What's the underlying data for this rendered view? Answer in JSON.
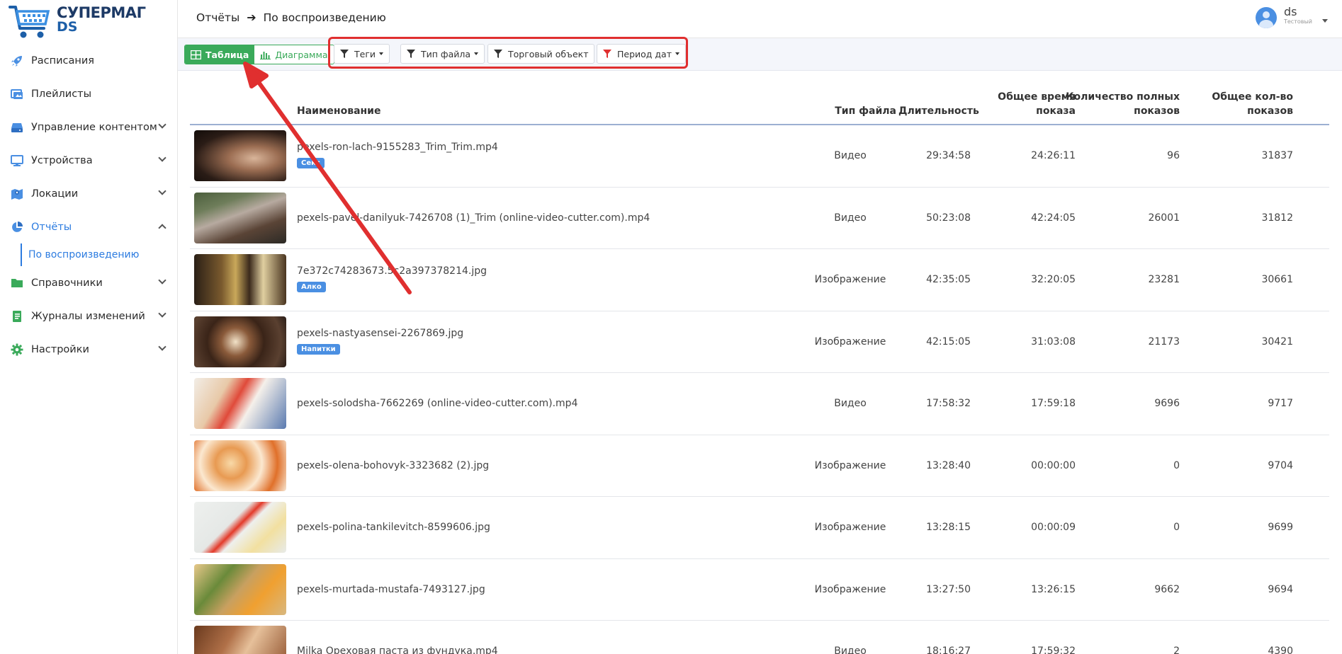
{
  "logo": {
    "line1": "СУПЕРМАГ",
    "line2": "DS"
  },
  "sidebar": {
    "items": [
      {
        "label": "Расписания",
        "icon": "rocket-icon"
      },
      {
        "label": "Плейлисты",
        "icon": "playlist-icon"
      },
      {
        "label": "Управление контентом",
        "icon": "storage-icon"
      },
      {
        "label": "Устройства",
        "icon": "monitor-icon"
      },
      {
        "label": "Локации",
        "icon": "map-icon"
      },
      {
        "label": "Отчёты",
        "icon": "pie-chart-icon"
      },
      {
        "label": "Справочники",
        "icon": "folder-icon"
      },
      {
        "label": "Журналы изменений",
        "icon": "journal-icon"
      },
      {
        "label": "Настройки",
        "icon": "gear-icon"
      }
    ],
    "sub": {
      "label": "По воспроизведению"
    }
  },
  "header": {
    "crumb1": "Отчёты",
    "crumb2": "По воспроизведению",
    "user": "ds",
    "role": "Тестовый"
  },
  "toolbar": {
    "table_label": "Таблица",
    "chart_label": "Диаграмма",
    "filters": [
      "Теги",
      "Тип файла",
      "Торговый объект",
      "Период дат"
    ]
  },
  "table": {
    "headers": {
      "name": "Наименование",
      "type": "Тип файла",
      "duration": "Длительность",
      "total_time_1": "Общее время",
      "total_time_2": "показа",
      "full_count_1": "Количество полных",
      "full_count_2": "показов",
      "total_count_1": "Общее кол-во",
      "total_count_2": "показов"
    },
    "rows": [
      {
        "name": "pexels-ron-lach-9155283_Trim_Trim.mp4",
        "tag": "Секс",
        "type": "Видео",
        "duration": "29:34:58",
        "total_time": "24:26:11",
        "full": "96",
        "total": "31837"
      },
      {
        "name": "pexels-pavel-danilyuk-7426708 (1)_Trim (online-video-cutter.com).mp4",
        "tag": "",
        "type": "Видео",
        "duration": "50:23:08",
        "total_time": "42:24:05",
        "full": "26001",
        "total": "31812"
      },
      {
        "name": "7e372c74283673.5c2a397378214.jpg",
        "tag": "Алко",
        "type": "Изображение",
        "duration": "42:35:05",
        "total_time": "32:20:05",
        "full": "23281",
        "total": "30661"
      },
      {
        "name": "pexels-nastyasensei-2267869.jpg",
        "tag": "Напитки",
        "type": "Изображение",
        "duration": "42:15:05",
        "total_time": "31:03:08",
        "full": "21173",
        "total": "30421"
      },
      {
        "name": "pexels-solodsha-7662269 (online-video-cutter.com).mp4",
        "tag": "",
        "type": "Видео",
        "duration": "17:58:32",
        "total_time": "17:59:18",
        "full": "9696",
        "total": "9717"
      },
      {
        "name": "pexels-olena-bohovyk-3323682 (2).jpg",
        "tag": "",
        "type": "Изображение",
        "duration": "13:28:40",
        "total_time": "00:00:00",
        "full": "0",
        "total": "9704"
      },
      {
        "name": "pexels-polina-tankilevitch-8599606.jpg",
        "tag": "",
        "type": "Изображение",
        "duration": "13:28:15",
        "total_time": "00:00:09",
        "full": "0",
        "total": "9699"
      },
      {
        "name": "pexels-murtada-mustafa-7493127.jpg",
        "tag": "",
        "type": "Изображение",
        "duration": "13:27:50",
        "total_time": "13:26:15",
        "full": "9662",
        "total": "9694"
      },
      {
        "name": "Milka Ореховая паста из фундука.mp4",
        "tag": "",
        "type": "Видео",
        "duration": "18:16:27",
        "total_time": "17:59:32",
        "full": "2",
        "total": "4390"
      }
    ]
  },
  "colors": {
    "accent": "#2d7ce0",
    "green": "#3aaa5a",
    "annotation": "#e02f2f"
  }
}
